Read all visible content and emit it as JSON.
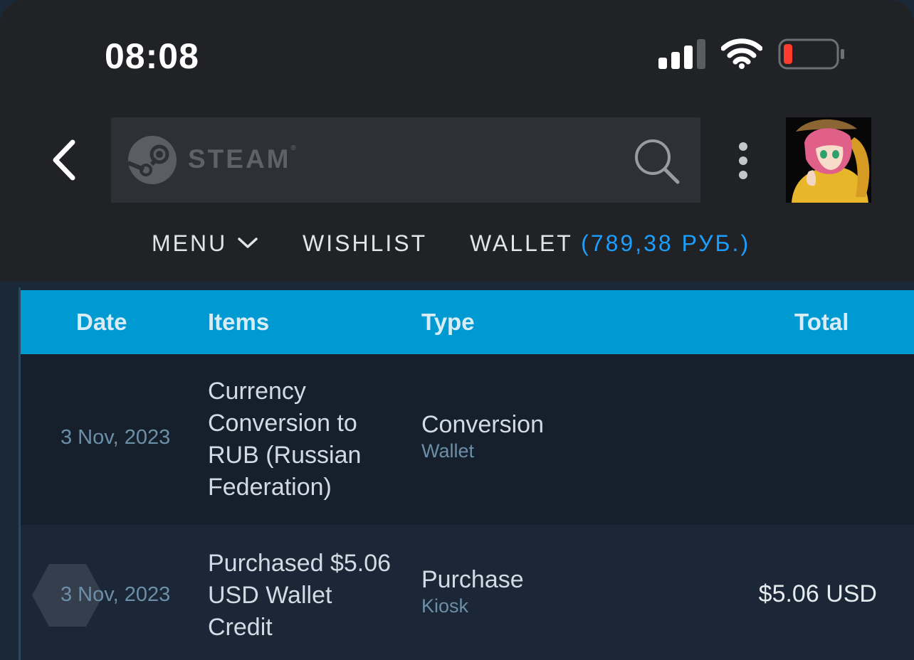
{
  "status_bar": {
    "time": "08:08",
    "icons": [
      "cellular-signal-icon",
      "wifi-icon",
      "battery-low-icon"
    ]
  },
  "header": {
    "back_icon": "chevron-left-icon",
    "brand_word": "STEAM",
    "brand_reg": "®",
    "search_icon": "search-icon",
    "more_icon": "more-vertical-icon",
    "avatar_icon": "user-avatar"
  },
  "nav": {
    "menu_label": "MENU",
    "wishlist_label": "WISHLIST",
    "wallet_label": "WALLET",
    "wallet_balance": "(789,38 РУБ.)"
  },
  "table": {
    "headers": {
      "date": "Date",
      "items": "Items",
      "type": "Type",
      "total": "Total"
    },
    "rows": [
      {
        "date": "3 Nov, 2023",
        "items": "Currency Conversion to RUB (Russian Federation)",
        "type": "Conversion",
        "type_sub": "Wallet",
        "total": ""
      },
      {
        "date": "3 Nov, 2023",
        "items": "Purchased $5.06 USD Wallet Credit",
        "type": "Purchase",
        "type_sub": "Kiosk",
        "total": "$5.06 USD"
      }
    ]
  },
  "colors": {
    "header_bg": "#212225",
    "table_header": "#009ad2",
    "row_dark": "#16202d",
    "row_alt": "#1b2636",
    "wallet_blue": "#1a9fff",
    "battery_red": "#ff3b30"
  }
}
